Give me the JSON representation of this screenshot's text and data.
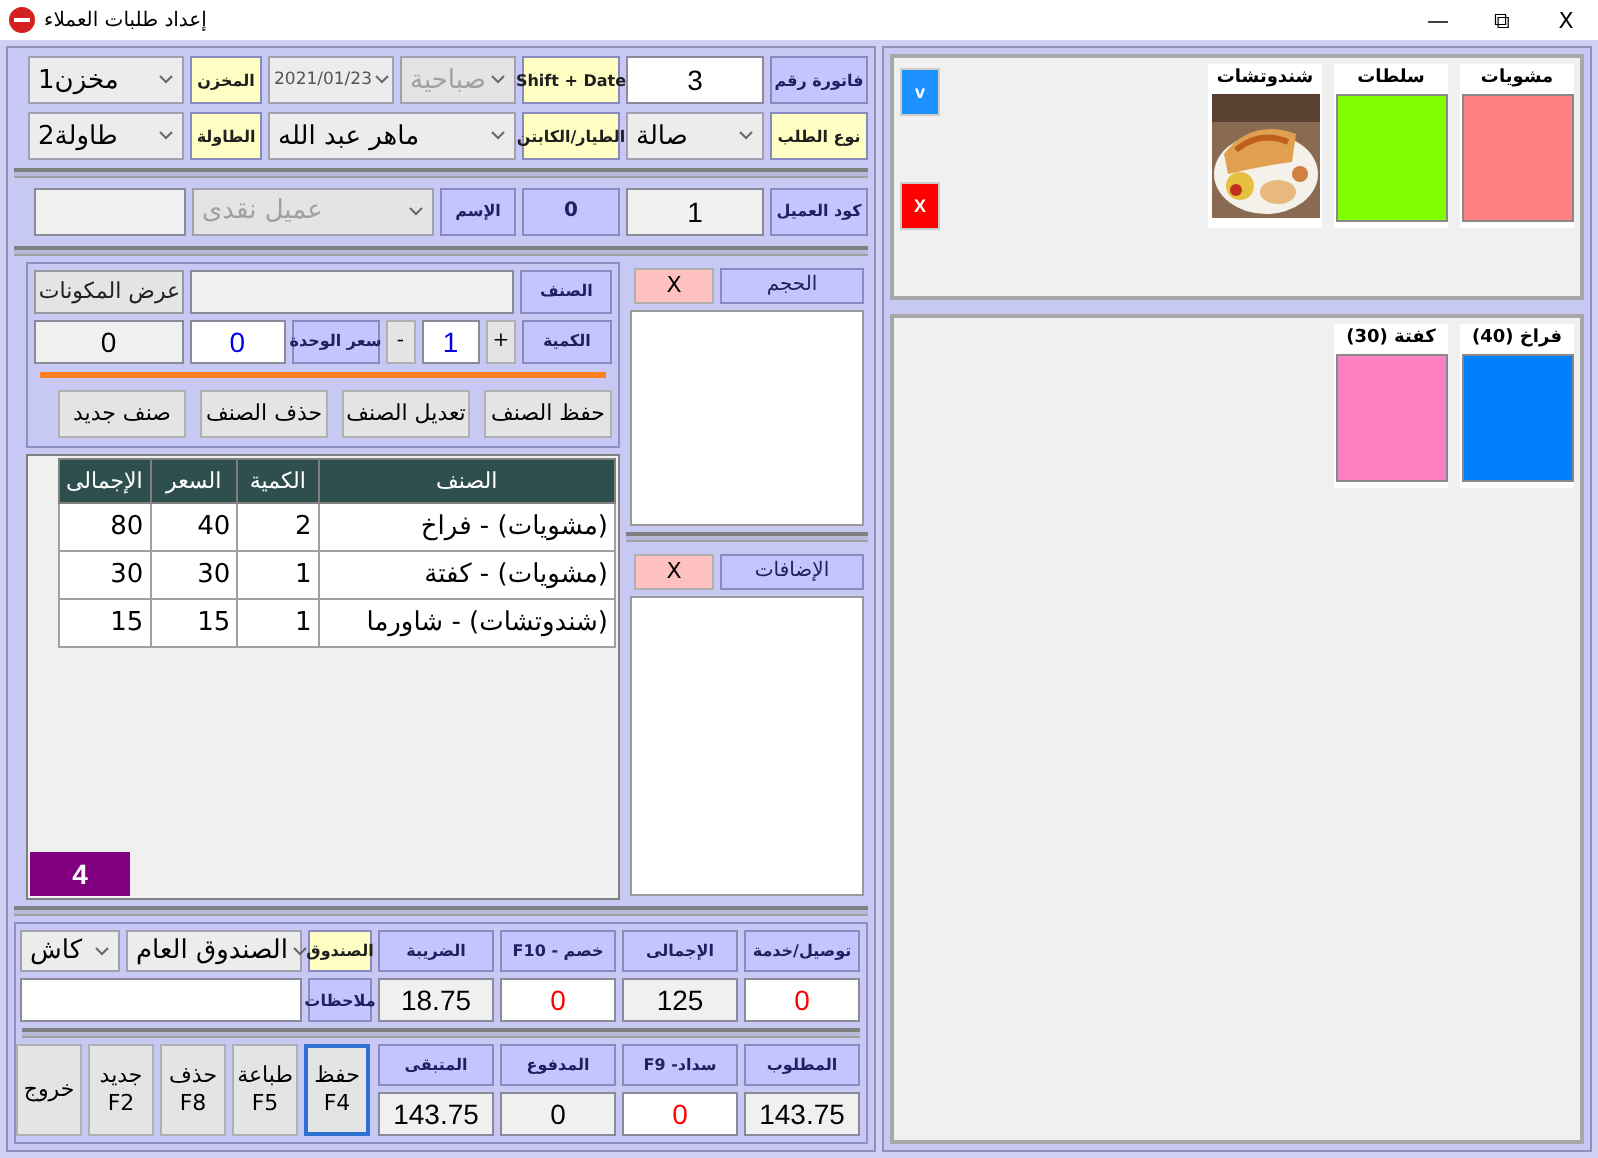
{
  "window": {
    "title": "إعداد طلبات العملاء",
    "controls": [
      "X",
      "⧉",
      "—"
    ]
  },
  "header": {
    "invoice_label": "فاتورة رقم",
    "invoice_number": "3",
    "shift_button": "Shift + Date",
    "shift": {
      "value": "صباحية",
      "disabled": true
    },
    "date": "2021/01/23",
    "store_label": "المخزن",
    "store": "مخزن1",
    "order_type_label": "نوع الطلب",
    "order_type": "صالة",
    "driver_label": "الطيار/الكابتن",
    "driver": "ماهر عبد الله",
    "table_label": "الطاولة",
    "table": "طاولة2"
  },
  "customer": {
    "code_label": "كود العميل",
    "code": "1",
    "id": "0",
    "name_label": "الإسم",
    "name": {
      "value": "عميل نقدى",
      "disabled": true
    }
  },
  "item_entry": {
    "item_label": "الصنف",
    "components_button": "عرض المكونات",
    "qty_label": "الكمية",
    "plus": "+",
    "qty": "1",
    "minus": "-",
    "unit_price_label": "سعر الوحدة",
    "unit_price": "0",
    "line_total": "0",
    "buttons": [
      "حفظ الصنف",
      "تعديل الصنف",
      "حذف الصنف",
      "صنف جديد"
    ]
  },
  "order_table": {
    "columns": [
      "الصنف",
      "الكمية",
      "السعر",
      "الإجمالى"
    ],
    "rows": [
      [
        "(مشويات) - فراخ",
        "2",
        "40",
        "80"
      ],
      [
        "(مشويات) - كفتة",
        "1",
        "30",
        "30"
      ],
      [
        "(شندوتشات) - شاورما",
        "1",
        "15",
        "15"
      ]
    ],
    "count": "4"
  },
  "size_panel": {
    "title": "الحجم",
    "clear": "X"
  },
  "additions_panel": {
    "title": "الإضافات",
    "clear": "X"
  },
  "totals": {
    "top": [
      {
        "label": "توصيل/خدمة",
        "value": "0",
        "kind": "input"
      },
      {
        "label": "الإجمالى",
        "value": "125",
        "kind": "readonly"
      },
      {
        "label": "خصم - F10",
        "value": "0",
        "kind": "input"
      },
      {
        "label": "الضريبة",
        "value": "18.75",
        "kind": "readonly"
      }
    ],
    "cashbox_label": "الصندوق",
    "cashbox": "الصندوق العام",
    "payment": "كاش",
    "notes_label": "ملاحظات",
    "bottom": [
      {
        "label": "المطلوب",
        "value": "143.75",
        "kind": "readonly"
      },
      {
        "label": "سداد- F9",
        "value": "0",
        "kind": "input"
      },
      {
        "label": "المدفوع",
        "value": "0",
        "kind": "readonly"
      },
      {
        "label": "المتبقى",
        "value": "143.75",
        "kind": "readonly"
      }
    ]
  },
  "actions": [
    {
      "label": "حفظ",
      "key": "F4",
      "focused": true
    },
    {
      "label": "طباعة",
      "key": "F5",
      "focused": false
    },
    {
      "label": "حذف",
      "key": "F8",
      "focused": false
    },
    {
      "label": "جديد",
      "key": "F2",
      "focused": false
    },
    {
      "label": "خروج",
      "focused": false
    }
  ],
  "menu": {
    "nav": [
      {
        "label": "v",
        "color": "#1e90ff"
      },
      {
        "label": "X",
        "color": "#ff0000"
      }
    ],
    "categories": [
      {
        "label": "مشويات",
        "kind": "color",
        "color": "#ff8080"
      },
      {
        "label": "سلطات",
        "kind": "color",
        "color": "#80ff00"
      },
      {
        "label": "شندوتشات",
        "kind": "picture"
      }
    ],
    "items": [
      {
        "label": "فراخ (40)",
        "color": "#0080ff"
      },
      {
        "label": "كفتة (30)",
        "color": "#ff80c0"
      }
    ]
  }
}
